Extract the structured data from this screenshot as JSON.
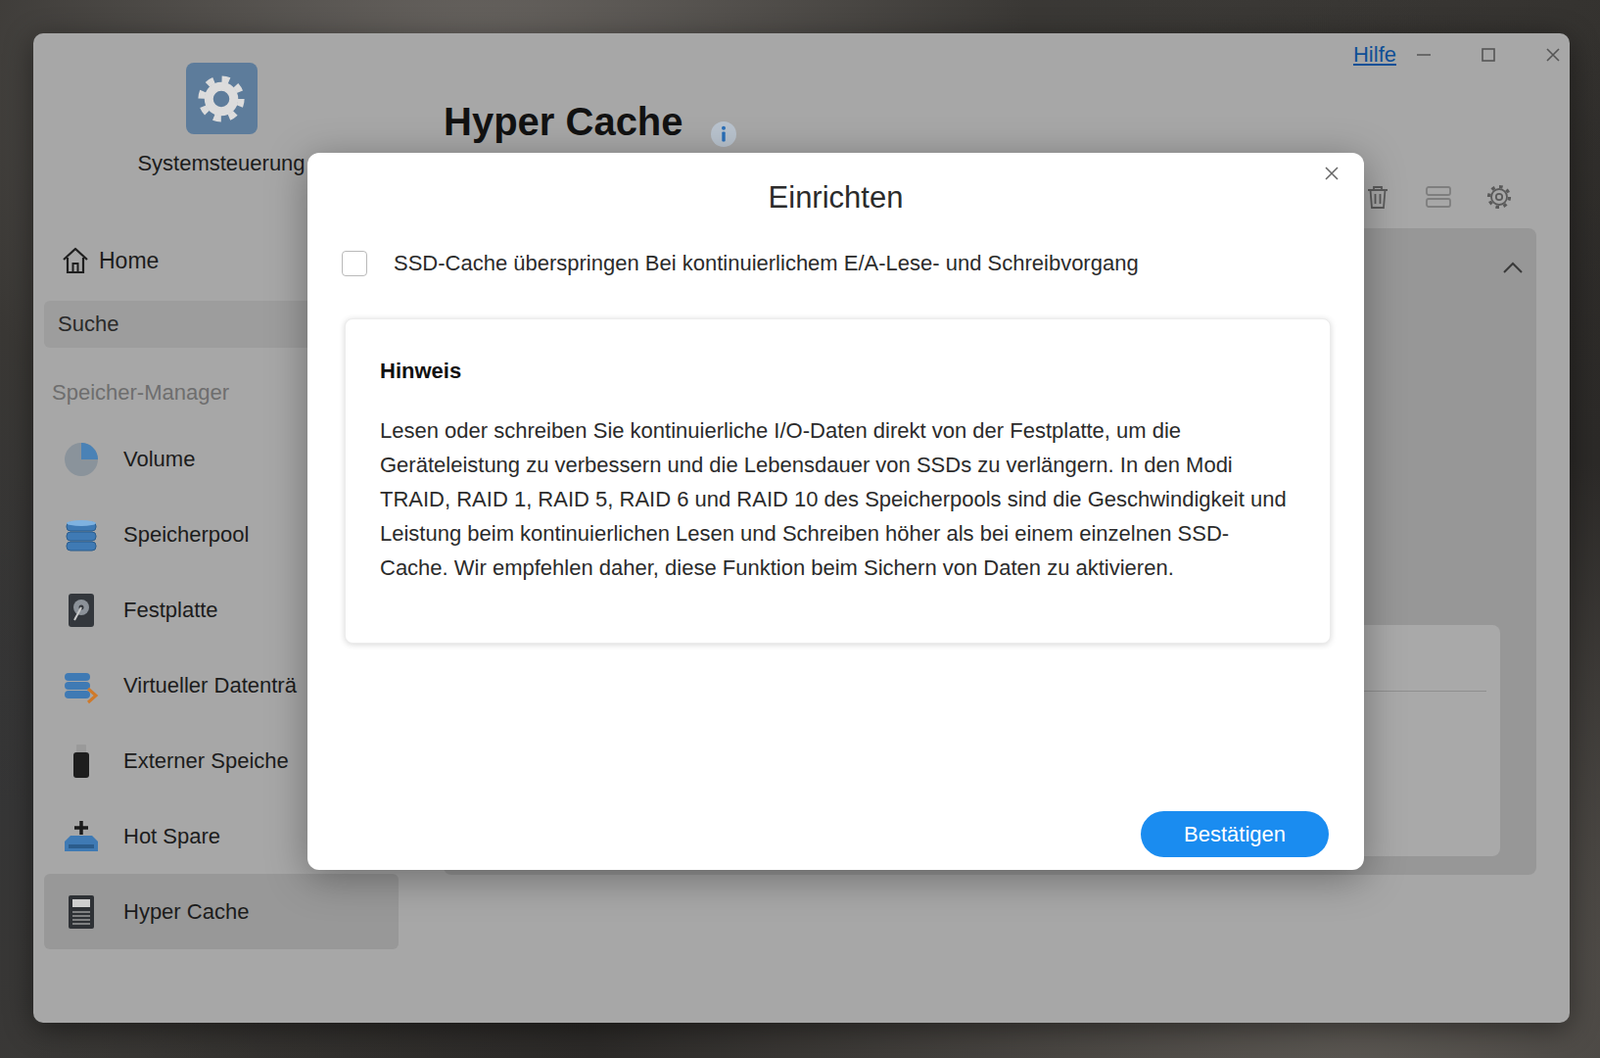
{
  "window": {
    "title": "Systemsteuerung",
    "help": "Hilfe"
  },
  "sidebar": {
    "home": "Home",
    "search": {
      "placeholder": "Suche"
    },
    "section": "Speicher-Manager",
    "items": [
      {
        "label": "Volume",
        "selected": false
      },
      {
        "label": "Speicherpool",
        "selected": false
      },
      {
        "label": "Festplatte",
        "selected": false
      },
      {
        "label": "Virtueller Datenträ",
        "selected": false
      },
      {
        "label": "Externer Speiche",
        "selected": false
      },
      {
        "label": "Hot Spare",
        "selected": false
      },
      {
        "label": "Hyper Cache",
        "selected": true
      }
    ]
  },
  "page": {
    "title": "Hyper Cache"
  },
  "dialog": {
    "title": "Einrichten",
    "option": {
      "label": "SSD-Cache überspringen Bei kontinuierlichem E/A-Lese- und Schreibvorgang",
      "checked": false
    },
    "note": {
      "heading": "Hinweis",
      "text": "Lesen oder schreiben Sie kontinuierliche I/O-Daten direkt von der Festplatte, um die Geräteleistung zu verbessern und die Lebensdauer von SSDs zu verlängern. In den Modi TRAID, RAID 1, RAID 5, RAID 6 und RAID 10 des Speicherpools sind die Geschwindigkeit und Leistung beim kontinuierlichen Lesen und Schreiben höher als bei einem einzelnen SSD-Cache. Wir empfehlen daher, diese Funktion beim Sichern von Daten zu aktivieren."
    },
    "buttons": [
      "Bestätigen"
    ]
  }
}
